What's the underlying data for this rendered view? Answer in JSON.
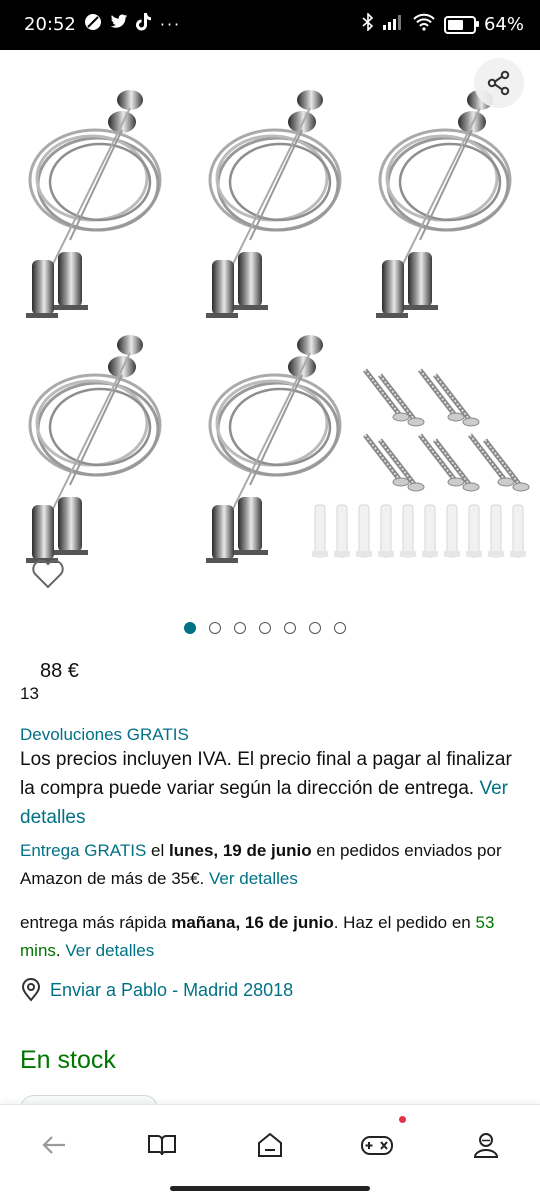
{
  "status_bar": {
    "time": "20:52",
    "battery_percent": "64%",
    "battery_level": 0.64,
    "icons": [
      "no-disturb-icon",
      "twitter-icon",
      "tiktok-icon",
      "more-icon",
      "bluetooth-icon",
      "signal-icon",
      "wifi-icon",
      "battery-icon"
    ]
  },
  "gallery": {
    "image_count": 7,
    "active_index": 0,
    "icons": [
      "share-icon",
      "heart-icon"
    ]
  },
  "price": {
    "main": "88 €",
    "cents": "13"
  },
  "returns_label": "Devoluciones GRATIS",
  "tax_note": "Los precios incluyen IVA. El precio final a pagar al finalizar la compra puede variar según la dirección de entrega.",
  "tax_link": "Ver detalles",
  "delivery": {
    "free_label": "Entrega GRATIS",
    "el": "el",
    "date": "lunes, 19 de junio",
    "rest": "en pedidos enviados por Amazon de más de 35€.",
    "link": "Ver detalles"
  },
  "fastest": {
    "prefix": "entrega más rápida",
    "date": "mañana, 16 de junio",
    "middle": ". Haz el pedido en",
    "countdown": "53 mins",
    "dot": ".",
    "link": "Ver detalles"
  },
  "address": {
    "label": "Enviar a Pablo - Madrid 28018",
    "icon": "location-pin-icon"
  },
  "stock": "En stock",
  "bottom_nav": {
    "items": [
      "back-icon",
      "book-icon",
      "home-icon",
      "games-icon",
      "profile-icon"
    ],
    "accent": "#e0334a"
  },
  "colors": {
    "link": "#007185",
    "stock": "#007600"
  }
}
